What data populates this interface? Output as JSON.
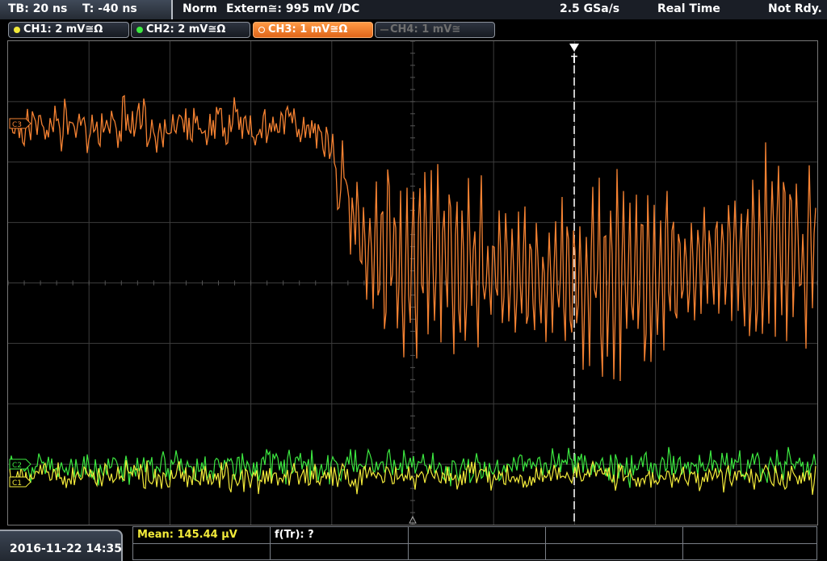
{
  "top": {
    "timebase": "TB: 20 ns",
    "trigger_time": "T: -40 ns",
    "mode": "Norm",
    "trigger_source": "Extern≅: 995 mV ∕DC",
    "sample_rate": "2.5 GSa/s",
    "acq_mode": "Real Time",
    "status": "Not Rdy."
  },
  "channels": [
    {
      "label": "CH1: 2 mV≅Ω",
      "color": "#f2ea3a",
      "active": false
    },
    {
      "label": "CH2: 2 mV≅Ω",
      "color": "#3ce840",
      "active": false
    },
    {
      "label": "CH3: 1 mV≅Ω",
      "color": "#ff8a2a",
      "active": true
    },
    {
      "label": "CH4: 1 mV≅",
      "color": "#777777",
      "active": false
    }
  ],
  "markers": {
    "trigger_label": "T",
    "ch3_marker": "C3",
    "ch2_marker": "C2",
    "ch1_marker": "C1"
  },
  "bottom": {
    "datetime": "2016-11-22 14:35",
    "measurement1": "Mean: 145.44 µV",
    "measurement2": "f(Tr): ?"
  },
  "colors": {
    "ch1": "#f2ea3a",
    "ch2": "#3ce840",
    "ch3": "#f58232",
    "grid": "#3c3c3c",
    "measurement_text": "#f2ea3a"
  }
}
